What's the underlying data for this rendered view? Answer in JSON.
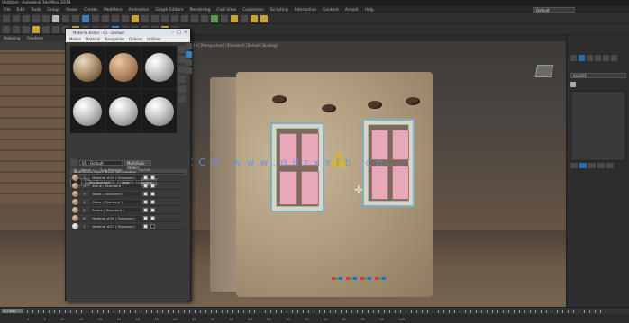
{
  "window": {
    "title": "Untitled - Autodesk 3ds Max 2019"
  },
  "menubar": {
    "items": [
      "File",
      "Edit",
      "Tools",
      "Group",
      "Views",
      "Create",
      "Modifiers",
      "Animation",
      "Graph Editors",
      "Rendering",
      "Civil View",
      "Customize",
      "Scripting",
      "Interactive",
      "Content",
      "Arnold",
      "Help"
    ],
    "workspace": "Default"
  },
  "ribbon": {
    "items": [
      "Modeling",
      "Freeform"
    ]
  },
  "viewport": {
    "label": "[+] [Perspective] [Standard] [Default Shading]",
    "watermark": "溜ZCG www.qdrxxfb.cn"
  },
  "material_editor": {
    "title": "Material Editor - 01 - Default",
    "menu": [
      "Modes",
      "Material",
      "Navigation",
      "Options",
      "Utilities"
    ],
    "material_name": "01 - Default",
    "material_type": "Multi/Sub-Object",
    "rollout": "Multi/Sub-Object Basic Parameters",
    "set_number_label": "Set Number",
    "set_number": "7",
    "add_label": "Add",
    "delete_label": "Delete",
    "table_headers": [
      "ID",
      "Name",
      "Sub-Material",
      "On/Off"
    ],
    "rows": [
      {
        "id": "1",
        "name": "",
        "sub": "Material #25 ( Standard )",
        "on": true
      },
      {
        "id": "2",
        "name": "",
        "sub": "Stone ( Standard )",
        "on": true
      },
      {
        "id": "3",
        "name": "",
        "sub": "Wood ( Standard )",
        "on": true
      },
      {
        "id": "4",
        "name": "",
        "sub": "Glass ( Standard )",
        "on": true
      },
      {
        "id": "5",
        "name": "",
        "sub": "Frame ( Standard )",
        "on": true
      },
      {
        "id": "6",
        "name": "",
        "sub": "Material #26 ( Standard )",
        "on": true
      },
      {
        "id": "7",
        "name": "",
        "sub": "Material #27 ( Standard )",
        "on": false
      }
    ]
  },
  "command_panel": {
    "object_name": "Box001"
  },
  "timeline": {
    "slider": "0 / 100",
    "ticks": [
      "0",
      "5",
      "10",
      "15",
      "20",
      "25",
      "30",
      "35",
      "40",
      "45",
      "50",
      "55",
      "60",
      "65",
      "70",
      "75",
      "80",
      "85",
      "90",
      "95",
      "100"
    ]
  }
}
